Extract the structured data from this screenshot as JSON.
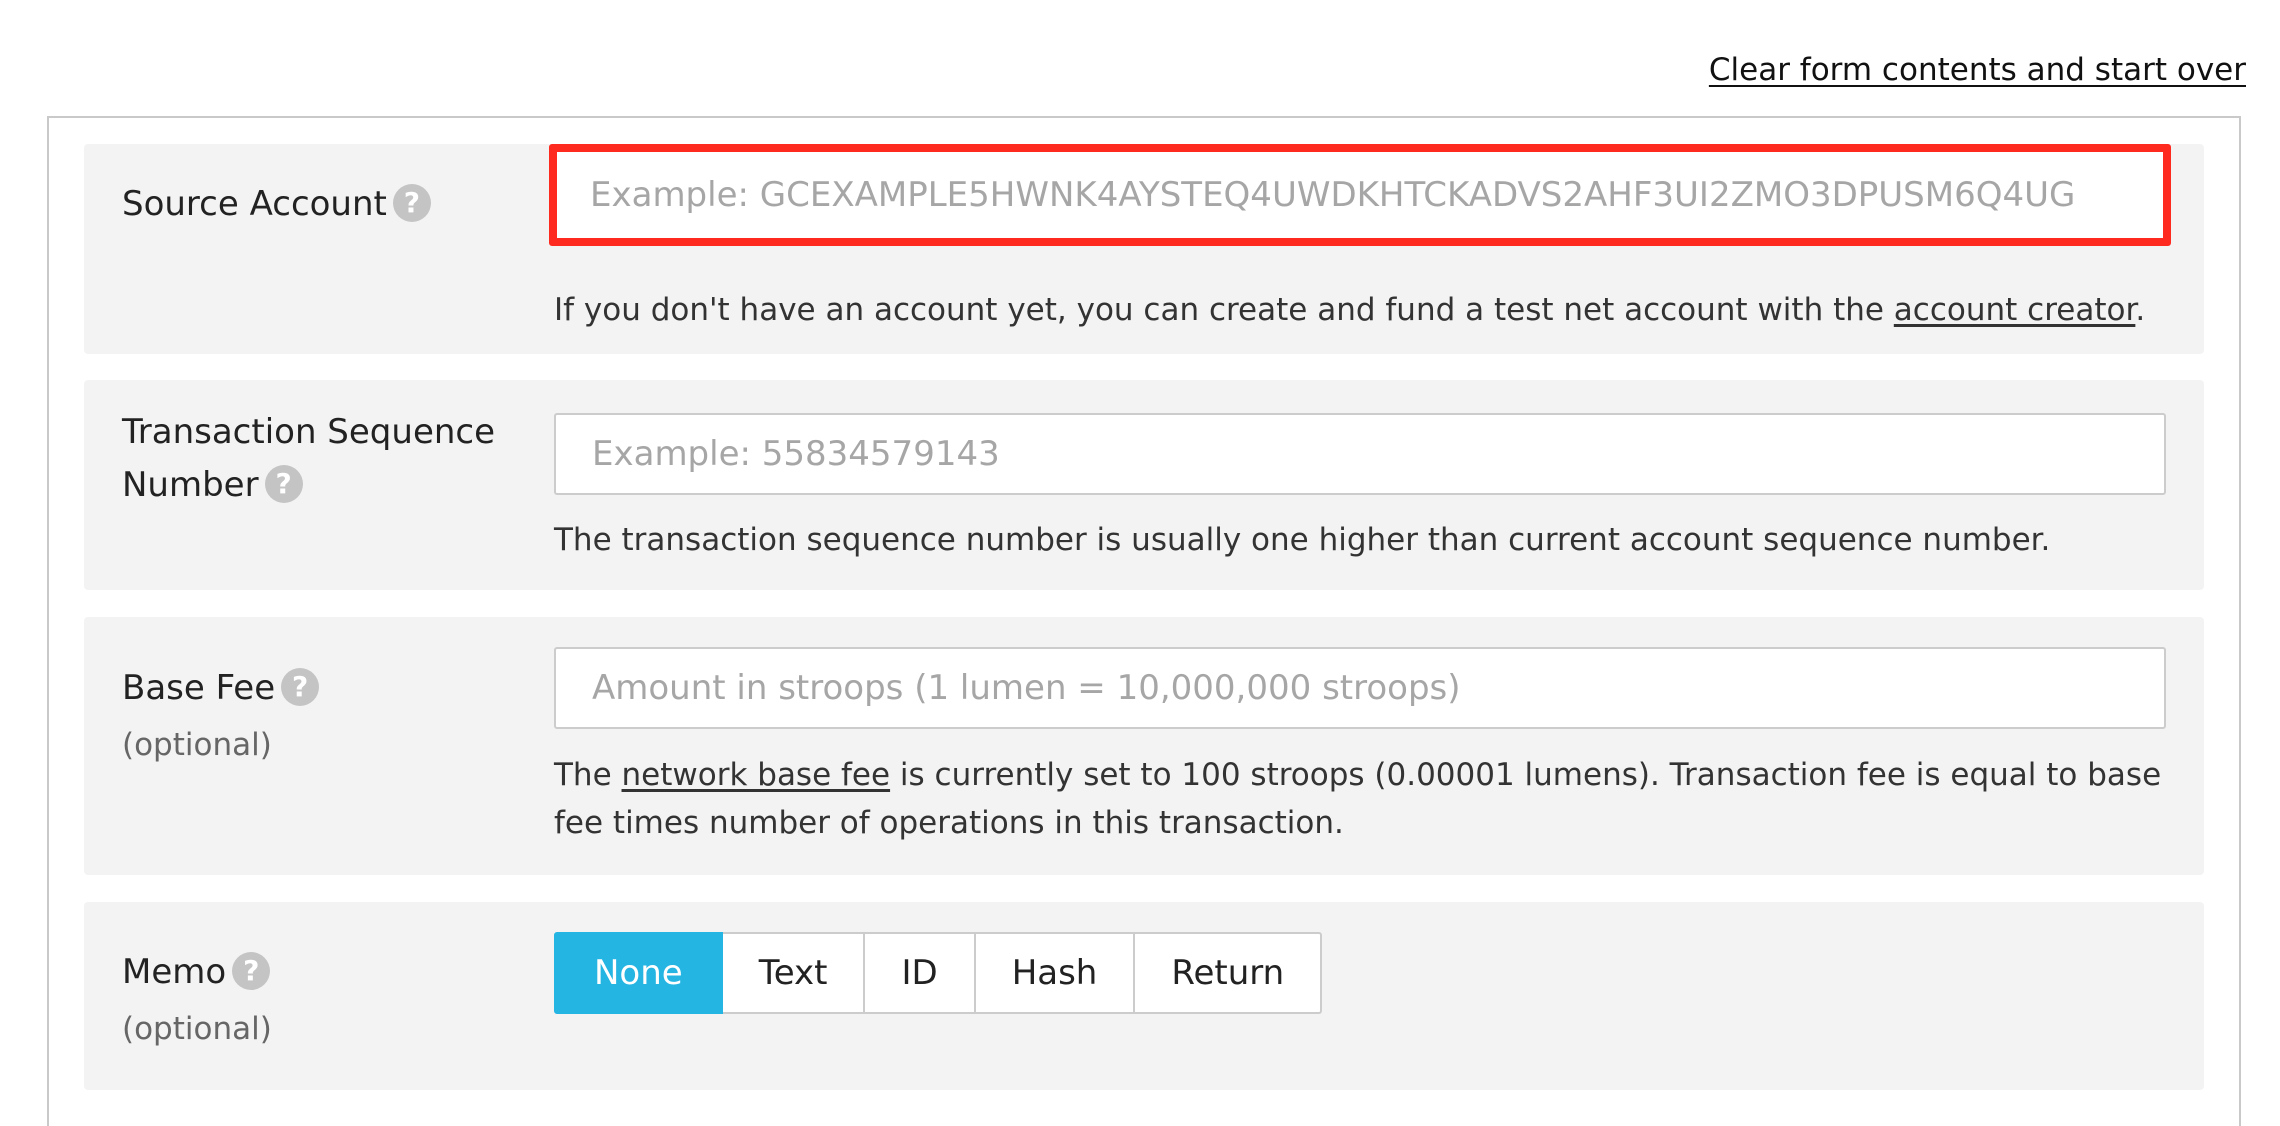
{
  "header": {
    "clear_link": "Clear form contents and start over"
  },
  "source_account": {
    "label": "Source Account",
    "placeholder": "Example: GCEXAMPLE5HWNK4AYSTEQ4UWDKHTCKADVS2AHF3UI2ZMO3DPUSM6Q4UG",
    "help_prefix": "If you don't have an account yet, you can create and fund a test net account with the ",
    "help_link": "account creator",
    "help_suffix": "."
  },
  "sequence_number": {
    "label_line1": "Transaction Sequence",
    "label_line2": "Number",
    "placeholder": "Example: 55834579143",
    "help": "The transaction sequence number is usually one higher than current account sequence number."
  },
  "base_fee": {
    "label": "Base Fee",
    "optional": "(optional)",
    "placeholder": "Amount in stroops (1 lumen = 10,000,000 stroops)",
    "help_prefix": "The ",
    "help_link": "network base fee",
    "help_suffix": " is currently set to 100 stroops (0.00001 lumens). Transaction fee is equal to base fee times number of operations in this transaction."
  },
  "memo": {
    "label": "Memo",
    "optional": "(optional)",
    "options": [
      "None",
      "Text",
      "ID",
      "Hash",
      "Return"
    ],
    "selected": "None"
  },
  "icons": {
    "help": "?"
  },
  "colors": {
    "accent": "#25b5e3",
    "highlight_border": "#ff2a1f",
    "row_background": "#f3f3f3"
  }
}
